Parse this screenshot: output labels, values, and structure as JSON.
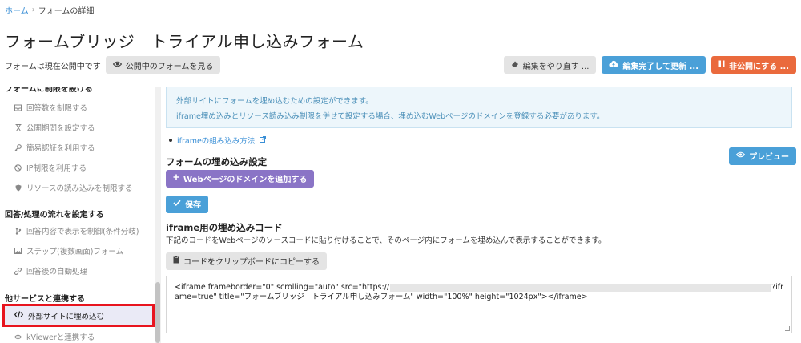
{
  "breadcrumb": {
    "home": "ホーム",
    "separator": "›",
    "current": "フォームの詳細"
  },
  "page_title": "フォームブリッジ　トライアル申し込みフォーム",
  "status": {
    "text": "フォームは現在公開中です",
    "view_public_label": "公開中のフォームを見る"
  },
  "actions": {
    "redo_label": "編集をやり直す ...",
    "update_label": "編集完了して更新 ...",
    "unpublish_label": "非公開にする ..."
  },
  "sidebar": {
    "clipped_heading": "フォームに制限を設ける",
    "restrict_items": [
      {
        "label": "回答数を制限する",
        "icon": "inbox-icon"
      },
      {
        "label": "公開期間を設定する",
        "icon": "hourglass-icon"
      },
      {
        "label": "簡易認証を利用する",
        "icon": "key-icon"
      },
      {
        "label": "IP制限を利用する",
        "icon": "ban-icon"
      },
      {
        "label": "リソースの読み込みを制限する",
        "icon": "shield-icon"
      }
    ],
    "flow_heading": "回答/処理の流れを設定する",
    "flow_items": [
      {
        "label": "回答内容で表示を制御(条件分岐)",
        "icon": "branch-icon"
      },
      {
        "label": "ステップ(複数画面)フォーム",
        "icon": "image-icon"
      },
      {
        "label": "回答後の自動処理",
        "icon": "link-icon"
      }
    ],
    "integrate_heading": "他サービスと連携する",
    "active_item": {
      "label": "外部サイトに埋め込む",
      "icon": "code-icon"
    },
    "next_item": {
      "label": "kViewerと連携する",
      "icon": "eye-icon"
    }
  },
  "info": {
    "line1": "外部サイトにフォームを埋め込むための設定ができます。",
    "line2": "iframe埋め込みとリソース読み込み制限を併せて設定する場合、埋め込むWebページのドメインを登録する必要があります。"
  },
  "howto_link": "iframeの組み込み方法",
  "preview_label": "プレビュー",
  "embed_settings": {
    "title": "フォームの埋め込み設定",
    "add_domain_label": "Webページのドメインを追加する",
    "save_label": "保存"
  },
  "code_section": {
    "title": "iframe用の埋め込みコード",
    "description": "下記のコードをWebページのソースコードに貼り付けることで、そのページ内にフォームを埋め込んで表示することができます。",
    "copy_label": "コードをクリップボードにコピーする",
    "code_part1": "<iframe frameborder=\"0\" scrolling=\"auto\" src=\"https://",
    "code_part2": "?ifr",
    "code_line2": "ame=true\" title=\"フォームブリッジ　トライアル申し込みフォーム\" width=\"100%\" height=\"1024px\"></iframe>"
  },
  "colors": {
    "accent_blue": "#4aa0d8",
    "orange": "#ea6a3d",
    "purple": "#8a74c6",
    "highlight_red": "#e8141e"
  }
}
